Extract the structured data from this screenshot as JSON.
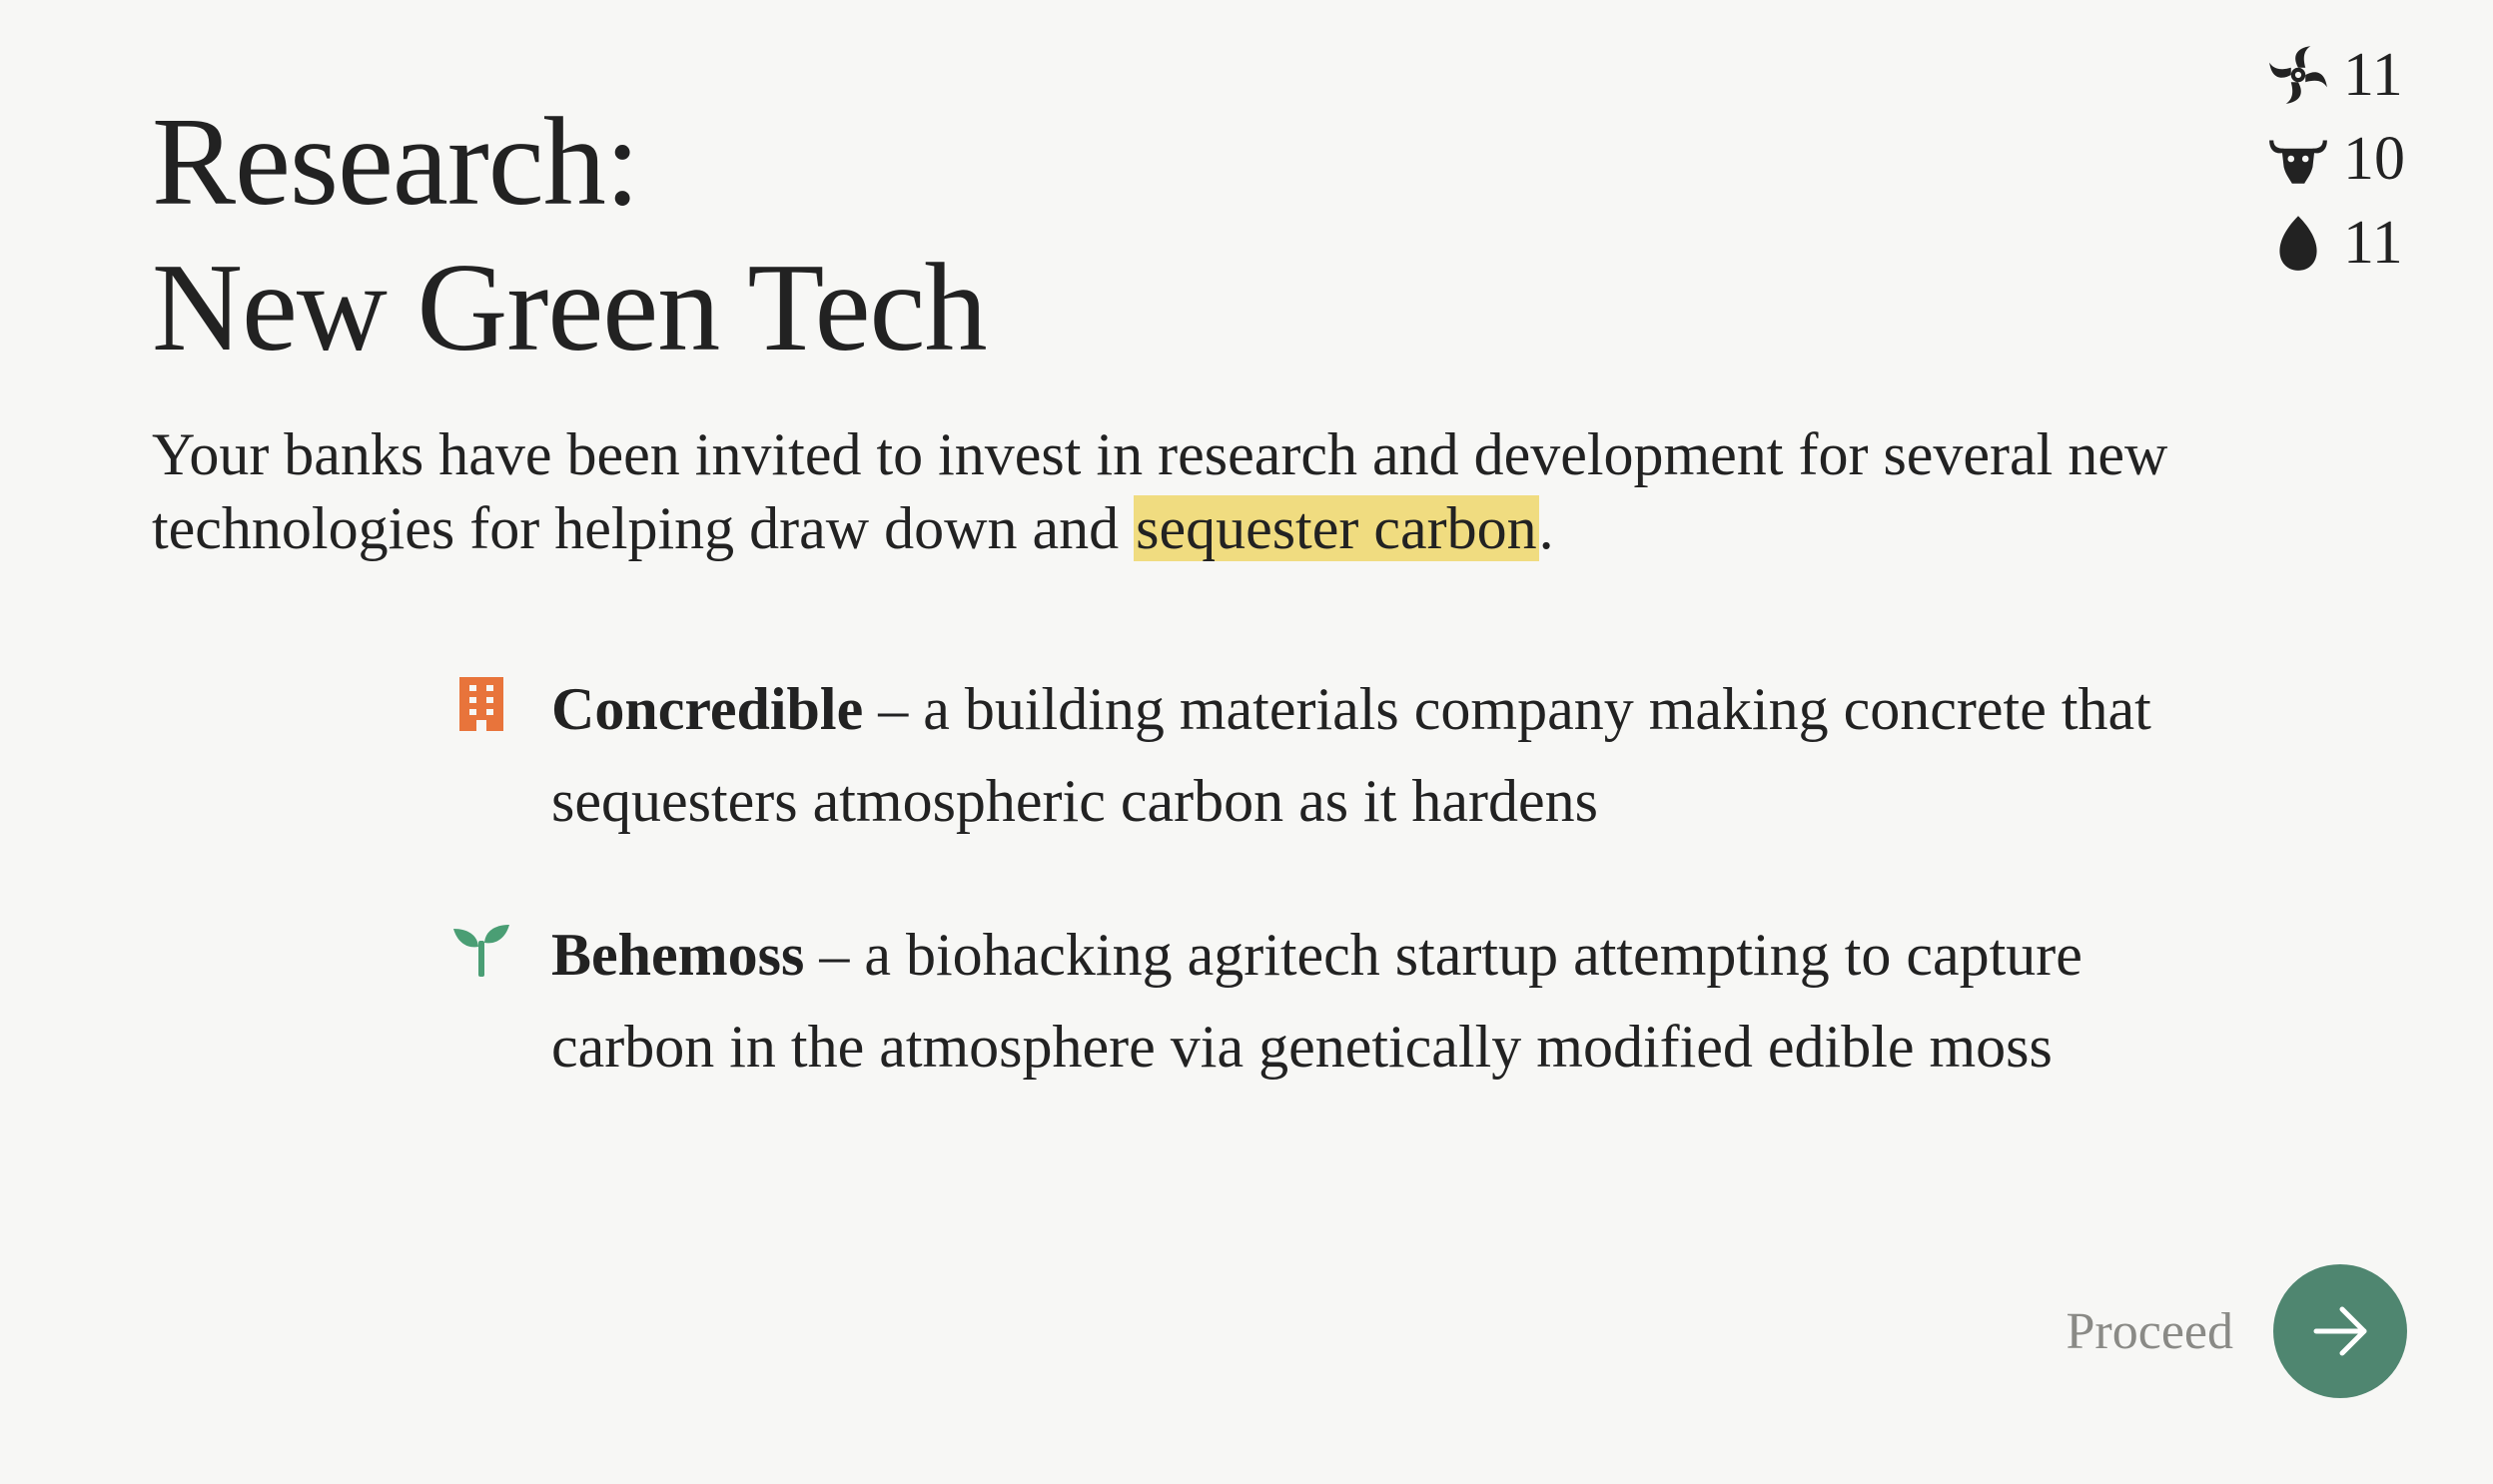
{
  "stats": [
    {
      "icon": "hurricane-icon",
      "value": "11"
    },
    {
      "icon": "bull-head-icon",
      "value": "10"
    },
    {
      "icon": "drop-icon",
      "value": "11"
    }
  ],
  "title": {
    "line1": "Research:",
    "line2": "New Green Tech"
  },
  "intro": {
    "before": "Your banks have been invited to invest in research and development for several new technologies for helping draw down and ",
    "highlight": "sequester carbon",
    "after": "."
  },
  "items": [
    {
      "icon": "building-icon",
      "name": "Concredible",
      "description": " – a building materials company making concrete that sequesters atmospheric carbon as it hardens"
    },
    {
      "icon": "sprout-icon",
      "name": "Behemoss",
      "description": " – a biohacking agritech startup attempting to capture carbon in the atmosphere via genetically modified edible moss"
    }
  ],
  "proceed": {
    "label": "Proceed",
    "icon": "arrow-right-icon"
  },
  "colors": {
    "background": "#f7f7f5",
    "text": "#222222",
    "highlight": "#f0dc80",
    "building": "#e8743b",
    "sprout": "#4a9e74",
    "proceed_button": "#4f8670",
    "proceed_label": "#8a8a86"
  }
}
